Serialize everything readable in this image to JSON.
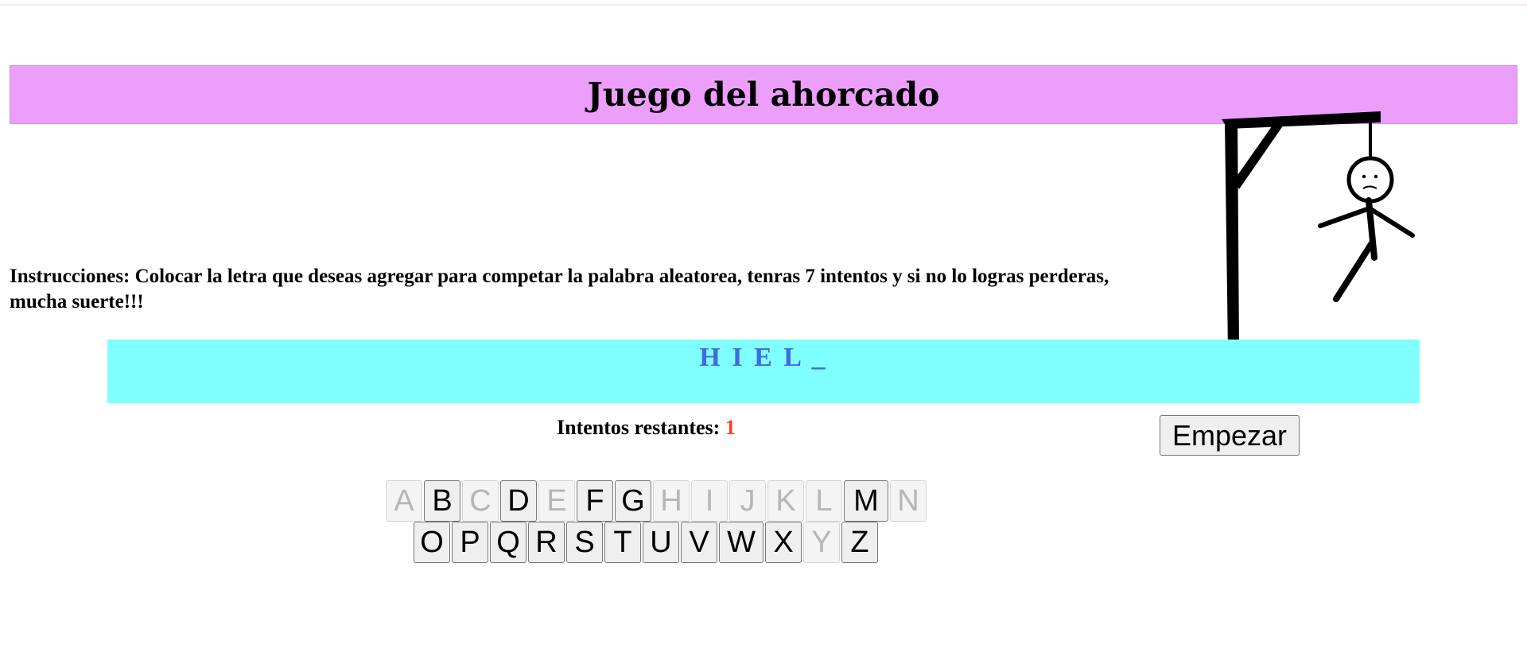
{
  "header": {
    "title": "Juego del ahorcado",
    "banner_color": "#eb9ffb"
  },
  "instructions": {
    "text": "Instrucciones: Colocar la letra que deseas agregar para competar la palabra aleatorea, tenras 7 intentos y si no lo logras perderas, mucha suerte!!!"
  },
  "game": {
    "hidden_word": "H I E L _",
    "word_color": "#4169e1",
    "word_banner_color": "#80ffff",
    "attempts_label": "Intentos restantes:",
    "attempts_remaining": "1",
    "attempts_color": "#ff3c1e",
    "start_button_label": "Empezar",
    "hangman_image": "hangman-stick-figure"
  },
  "keyboard": {
    "row1": [
      {
        "letter": "A",
        "used": true
      },
      {
        "letter": "B",
        "used": false
      },
      {
        "letter": "C",
        "used": true
      },
      {
        "letter": "D",
        "used": false
      },
      {
        "letter": "E",
        "used": true
      },
      {
        "letter": "F",
        "used": false
      },
      {
        "letter": "G",
        "used": false
      },
      {
        "letter": "H",
        "used": true
      },
      {
        "letter": "I",
        "used": true
      },
      {
        "letter": "J",
        "used": true
      },
      {
        "letter": "K",
        "used": true
      },
      {
        "letter": "L",
        "used": true
      },
      {
        "letter": "M",
        "used": false
      },
      {
        "letter": "N",
        "used": true
      }
    ],
    "row2": [
      {
        "letter": "O",
        "used": false
      },
      {
        "letter": "P",
        "used": false
      },
      {
        "letter": "Q",
        "used": false
      },
      {
        "letter": "R",
        "used": false
      },
      {
        "letter": "S",
        "used": false
      },
      {
        "letter": "T",
        "used": false
      },
      {
        "letter": "U",
        "used": false
      },
      {
        "letter": "V",
        "used": false
      },
      {
        "letter": "W",
        "used": false
      },
      {
        "letter": "X",
        "used": false
      },
      {
        "letter": "Y",
        "used": true
      },
      {
        "letter": "Z",
        "used": false
      }
    ]
  }
}
